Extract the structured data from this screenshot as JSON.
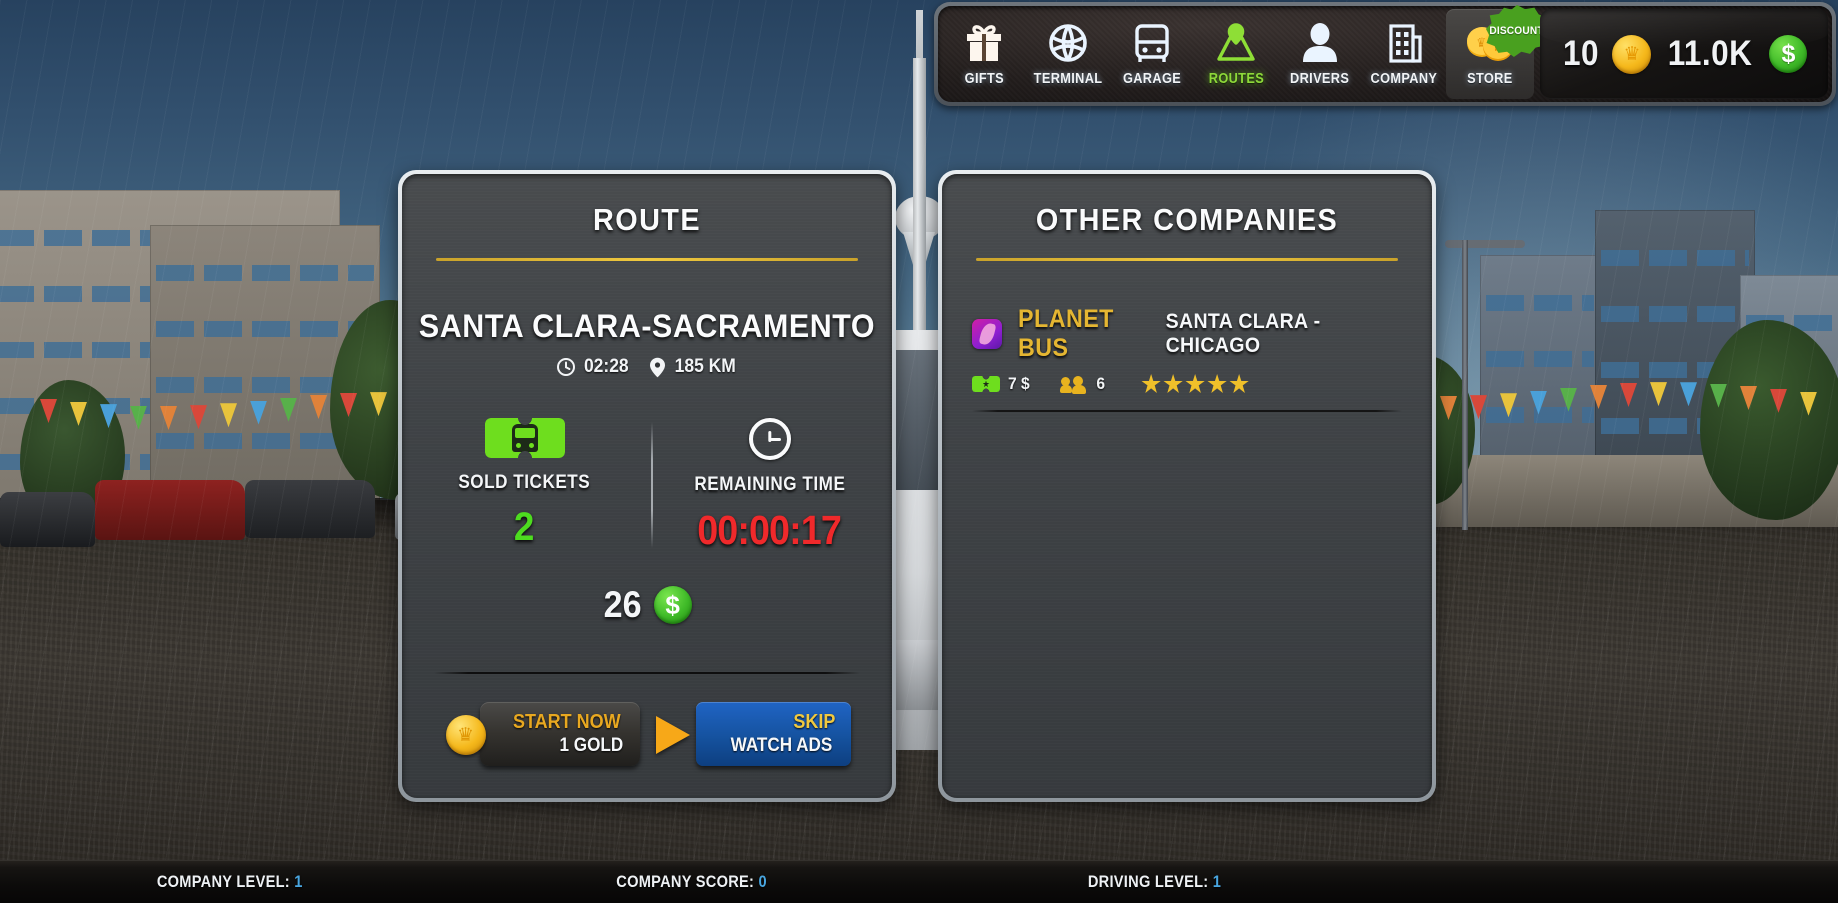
{
  "topbar": {
    "items": [
      {
        "label": "GIFTS",
        "icon": "gift-icon",
        "active": false
      },
      {
        "label": "TERMINAL",
        "icon": "globe-icon",
        "active": false
      },
      {
        "label": "GARAGE",
        "icon": "bus-front-icon",
        "active": false
      },
      {
        "label": "ROUTES",
        "icon": "map-pin-icon",
        "active": true
      },
      {
        "label": "DRIVERS",
        "icon": "person-icon",
        "active": false
      },
      {
        "label": "COMPANY",
        "icon": "building-icon",
        "active": false
      },
      {
        "label": "STORE",
        "icon": "coins-icon",
        "active": false
      }
    ],
    "discount_badge": "DISCOUNT",
    "gold_amount": "10",
    "money_amount": "11.0K",
    "accent_active": "#8ed93a",
    "gold_color": "#f5b81b",
    "money_color": "#3fba28"
  },
  "route_panel": {
    "title": "ROUTE",
    "route_name": "SANTA CLARA-SACRAMENTO",
    "duration": "02:28",
    "distance": "185 KM",
    "sold_tickets_label": "SOLD TICKETS",
    "sold_tickets_value": "2",
    "remaining_time_label": "REMAINING TIME",
    "remaining_time_value": "00:00:17",
    "reward_value": "26",
    "start_now_label": "START NOW",
    "start_now_cost": "1 GOLD",
    "skip_label": "SKIP",
    "skip_sub_label": "WATCH ADS",
    "rule_color": "#e0b52f",
    "green_value_color": "#4ddc1f",
    "red_value_color": "#f0292b"
  },
  "companies_panel": {
    "title": "OTHER COMPANIES",
    "rows": [
      {
        "name": "PLANET BUS",
        "route": "SANTA CLARA - CHICAGO",
        "ticket_price": "7 $",
        "passengers": "6",
        "stars": 5,
        "logo_color": "#b41fbe",
        "name_color": "#e5b632"
      }
    ]
  },
  "bottombar": {
    "company_level_label": "COMPANY LEVEL: ",
    "company_level_value": "1",
    "company_score_label": "COMPANY SCORE: ",
    "company_score_value": "0",
    "driving_level_label": "DRIVING LEVEL: ",
    "driving_level_value": "1",
    "value_color": "#49a6e0"
  }
}
